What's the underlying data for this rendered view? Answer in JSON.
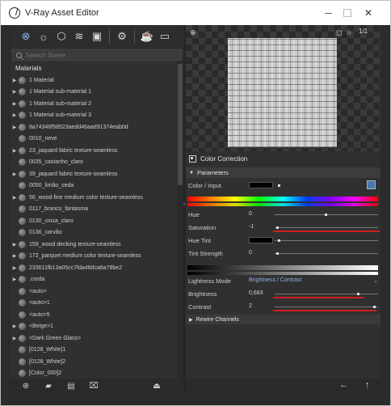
{
  "window": {
    "title": "V-Ray Asset Editor"
  },
  "left_panel": {
    "search_placeholder": "Search Scene",
    "section_label": "Materials",
    "items": [
      {
        "label": "1 Material",
        "expandable": true
      },
      {
        "label": "1 Material sub-material 1",
        "expandable": true
      },
      {
        "label": "1 Material sub-material 2",
        "expandable": true
      },
      {
        "label": "1 Material sub-material 3",
        "expandable": true
      },
      {
        "label": "8a74346f58523aedd46aad91374eab0d",
        "expandable": true
      },
      {
        "label": "0010_neve",
        "expandable": false
      },
      {
        "label": "23_jaquard fabric texture-seamless",
        "expandable": true
      },
      {
        "label": "0035_castanho_claro",
        "expandable": false
      },
      {
        "label": "39_jaquard fabric texture-seamless",
        "expandable": true
      },
      {
        "label": "0050_limão_seda",
        "expandable": false
      },
      {
        "label": "56_wood fine medium color texture-seamless",
        "expandable": true
      },
      {
        "label": "0117_branco_fantasma",
        "expandable": false
      },
      {
        "label": "0130_cinza_claro",
        "expandable": false
      },
      {
        "label": "0136_carvão",
        "expandable": false
      },
      {
        "label": "159_wood decking texture-seamless",
        "expandable": true
      },
      {
        "label": "172_parquet medium color texture-seamless",
        "expandable": true
      },
      {
        "label": "233611fb13a05cc7fda46dca6a79be2",
        "expandable": true
      },
      {
        "label": ".corda",
        "expandable": true
      },
      {
        "label": "<auto>",
        "expandable": false
      },
      {
        "label": "<auto>1",
        "expandable": false
      },
      {
        "label": "<auto>5",
        "expandable": false
      },
      {
        "label": "<Beige>1",
        "expandable": true
      },
      {
        "label": "<Dark Green Glass>",
        "expandable": true
      },
      {
        "label": "[0128_White]1",
        "expandable": false
      },
      {
        "label": "[0128_White]2",
        "expandable": false
      },
      {
        "label": "[Color_000]2",
        "expandable": false
      }
    ]
  },
  "preview": {
    "counter": "1/1"
  },
  "color_correction": {
    "title": "Color Correction",
    "parameters_label": "Parameters",
    "color_input_label": "Color / Input",
    "hue_label": "Hue",
    "hue_value": "0",
    "saturation_label": "Saturation",
    "saturation_value": "-1",
    "hue_tint_label": "Hue Tint",
    "tint_strength_label": "Tint Strength",
    "tint_strength_value": "0",
    "lightness_mode_label": "Lightness Mode",
    "lightness_mode_value": "Brightness / Contrast",
    "brightness_label": "Brightness",
    "brightness_value": "0,683",
    "contrast_label": "Contrast",
    "contrast_value": "2",
    "rewire_label": "Rewire Channels"
  },
  "colors": {
    "accent": "#8fb4e8",
    "highlight": "#d01e1e"
  }
}
